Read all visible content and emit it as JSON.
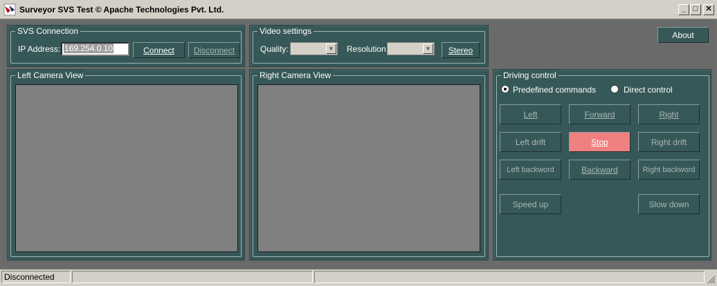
{
  "window": {
    "title": "Surveyor SVS Test © Apache Technologies Pvt. Ltd.",
    "minimize_label": "_",
    "maximize_label": "□",
    "close_label": "✕"
  },
  "svs_connection": {
    "legend": "SVS Connection",
    "ip_label": "IP Address:",
    "ip_value": "169.254.0.10",
    "connect_label": "Connect",
    "disconnect_label": "Disconnect"
  },
  "video_settings": {
    "legend": "Video settings",
    "quality_label": "Quality:",
    "quality_value": "",
    "resolution_label": "Resolution:",
    "resolution_value": "",
    "stereo_label": "Stereo"
  },
  "about_label": "About",
  "left_camera": {
    "legend": "Left Camera View"
  },
  "right_camera": {
    "legend": "Right Camera View"
  },
  "driving": {
    "legend": "Driving control",
    "mode_predefined": "Predefined commands",
    "mode_direct": "Direct control",
    "selected_mode": "predefined",
    "buttons": {
      "left": "Left",
      "forward": "Forward",
      "right": "Right",
      "left_drift": "Left drift",
      "stop": "Stop",
      "right_drift": "Right drift",
      "left_backward": "Left backword",
      "backward": "Backward",
      "right_backward": "Right backword",
      "speed_up": "Speed up",
      "slow_down": "Slow down"
    },
    "stop_color": "#f08080"
  },
  "status": {
    "text": "Disconnected"
  },
  "colors": {
    "panel": "#375858",
    "camera_view": "#808080",
    "background": "#6e6e6e"
  }
}
